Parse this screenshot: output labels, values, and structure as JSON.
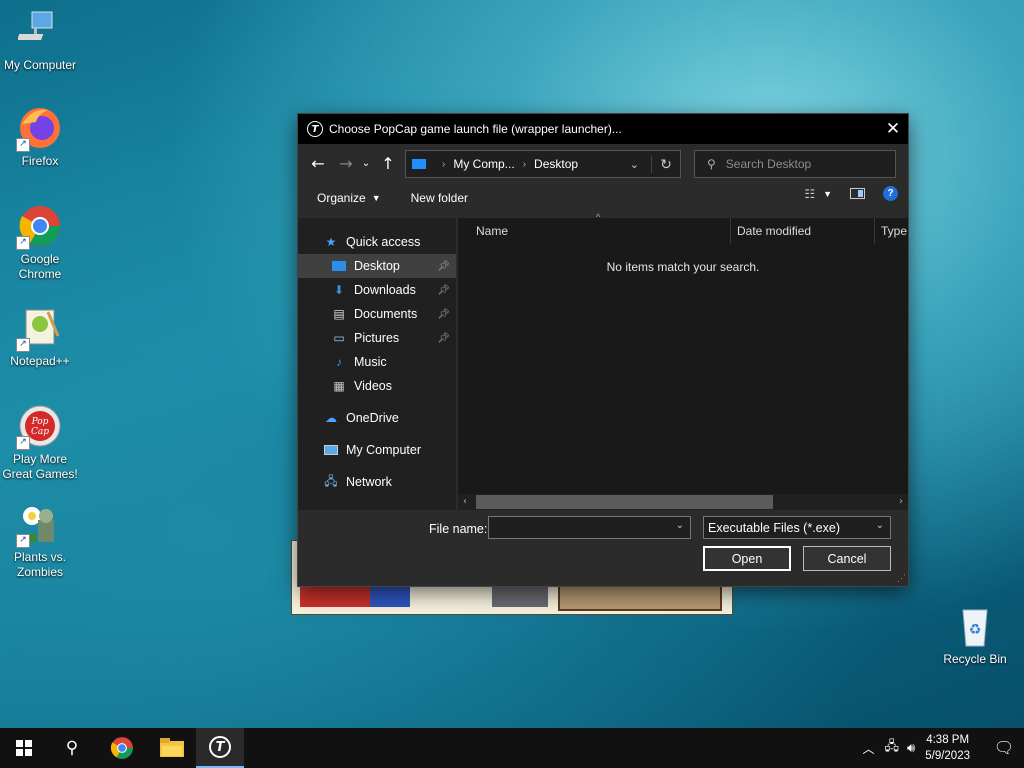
{
  "desktop": {
    "icons": [
      {
        "label": "My Computer",
        "icon": "computer-icon"
      },
      {
        "label": "Firefox",
        "icon": "firefox-icon"
      },
      {
        "label": "Google Chrome",
        "icon": "chrome-icon"
      },
      {
        "label": "Notepad++",
        "icon": "notepadpp-icon"
      },
      {
        "label": "Play More Great Games!",
        "icon": "popcap-icon"
      },
      {
        "label": "Plants vs. Zombies",
        "icon": "pvz-icon"
      },
      {
        "label": "Recycle Bin",
        "icon": "recycle-bin-icon"
      }
    ]
  },
  "dialog": {
    "title": "Choose PopCap game launch file (wrapper launcher)...",
    "address": {
      "crumbs": [
        "My Comp...",
        "Desktop"
      ]
    },
    "search_placeholder": "Search Desktop",
    "toolbar": {
      "organize": "Organize",
      "new_folder": "New folder"
    },
    "sidebar": [
      {
        "label": "Quick access",
        "icon": "star-icon",
        "indent": 0,
        "pinned": false,
        "selected": false
      },
      {
        "label": "Desktop",
        "icon": "desktop-folder-icon",
        "indent": 1,
        "pinned": true,
        "selected": true
      },
      {
        "label": "Downloads",
        "icon": "download-icon",
        "indent": 1,
        "pinned": true,
        "selected": false
      },
      {
        "label": "Documents",
        "icon": "document-icon",
        "indent": 1,
        "pinned": true,
        "selected": false
      },
      {
        "label": "Pictures",
        "icon": "picture-icon",
        "indent": 1,
        "pinned": true,
        "selected": false
      },
      {
        "label": "Music",
        "icon": "music-icon",
        "indent": 1,
        "pinned": false,
        "selected": false
      },
      {
        "label": "Videos",
        "icon": "video-icon",
        "indent": 1,
        "pinned": false,
        "selected": false
      },
      {
        "label": "OneDrive",
        "icon": "cloud-icon",
        "indent": 0,
        "pinned": false,
        "selected": false
      },
      {
        "label": "My Computer",
        "icon": "computer-icon",
        "indent": 0,
        "pinned": false,
        "selected": false
      },
      {
        "label": "Network",
        "icon": "network-icon",
        "indent": 0,
        "pinned": false,
        "selected": false
      }
    ],
    "columns": [
      "Name",
      "Date modified",
      "Type"
    ],
    "empty_message": "No items match your search.",
    "file_name_label": "File name:",
    "file_name_value": "",
    "filter": "Executable Files (*.exe)",
    "open_label": "Open",
    "cancel_label": "Cancel"
  },
  "taskbar": {
    "time": "4:38 PM",
    "date": "5/9/2023"
  }
}
